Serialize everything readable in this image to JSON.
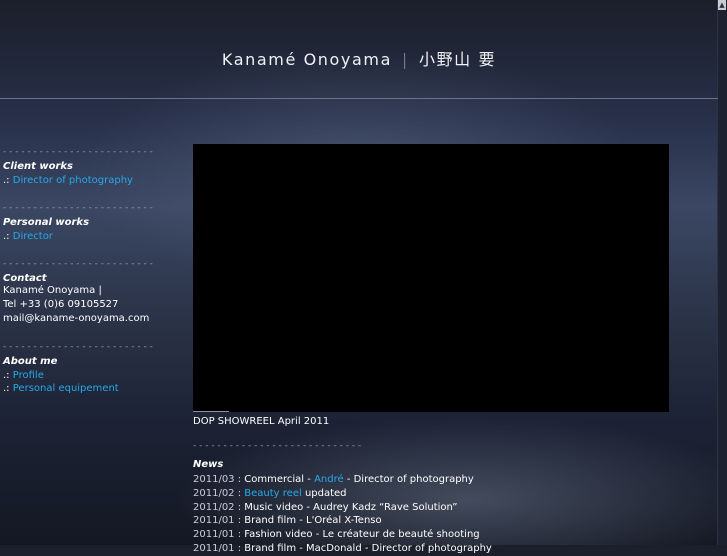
{
  "header": {
    "name_latin": "Kanamé Onoyama",
    "separator": "|",
    "name_japanese": "小野山 要"
  },
  "sidebar": {
    "dashes": "- - - - - - - - - - - - - - - - - - - - - - - - - -",
    "client_works": {
      "title": "Client works",
      "prefix": ".:",
      "link": "Director of photography"
    },
    "personal_works": {
      "title": "Personal works",
      "prefix": ".:",
      "link": "Director"
    },
    "contact": {
      "title": "Contact",
      "line1": "Kanamé Onoyama |",
      "line2": "Tel +33 (0)6 09105527",
      "line3": "mail@kaname-onoyama.com"
    },
    "about": {
      "title": "About me",
      "prefix": ".:",
      "link1": "Profile",
      "link2": "Personal equipement"
    }
  },
  "video": {
    "caption": "DOP SHOWREEL April 2011"
  },
  "news": {
    "dashes": "- - - - - - - - - - - - - - - - - - - - - - - - - - - -",
    "title": "News",
    "items": [
      {
        "date": "2011/03 :",
        "pre": " Commercial - ",
        "link": "André",
        "post": " - Director of photography"
      },
      {
        "date": "2011/02 :",
        "pre": " ",
        "link": "Beauty reel",
        "post": " updated"
      },
      {
        "date": "2011/02 :",
        "pre": " Music video - Audrey Kadz “Rave Solution”",
        "link": "",
        "post": ""
      },
      {
        "date": "2011/01 :",
        "pre": " Brand film - L'Oréal X-Tenso",
        "link": "",
        "post": ""
      },
      {
        "date": "2011/01 :",
        "pre": " Fashion video - Le créateur de beauté shooting",
        "link": "",
        "post": ""
      },
      {
        "date": "2011/01 :",
        "pre": " Brand film - MacDonald - Director of photography",
        "link": "",
        "post": ""
      }
    ]
  },
  "colors": {
    "link": "#26a9e8",
    "background": "#1f2535",
    "divider": "#6b7488"
  }
}
